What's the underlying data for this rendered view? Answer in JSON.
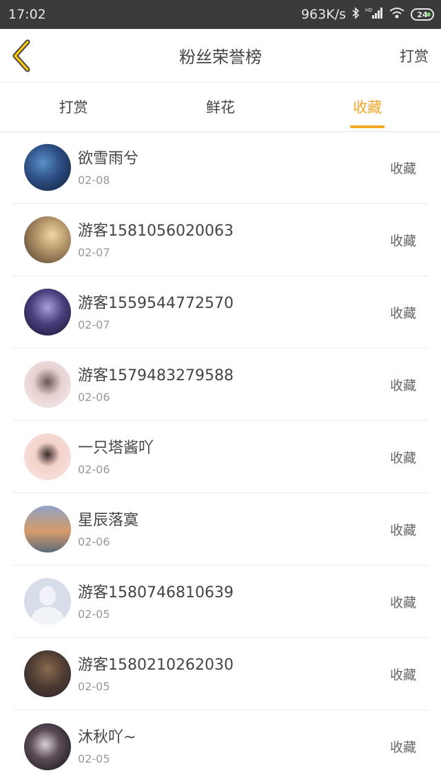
{
  "status_bar": {
    "time": "17:02",
    "network_speed": "963K/s",
    "battery": "24",
    "icons": [
      "bluetooth-icon",
      "hd-signal-icon",
      "wifi-icon",
      "battery-icon"
    ]
  },
  "header": {
    "back_icon": "chevron-left-icon",
    "title": "粉丝荣誉榜",
    "action": "打赏",
    "accent_color": "#f5a623"
  },
  "tabs": [
    {
      "label": "打赏",
      "active": false
    },
    {
      "label": "鲜花",
      "active": false
    },
    {
      "label": "收藏",
      "active": true
    }
  ],
  "list": [
    {
      "name": "欲雪雨兮",
      "date": "02-08",
      "label": "收藏"
    },
    {
      "name": "游客1581056020063",
      "date": "02-07",
      "label": "收藏"
    },
    {
      "name": "游客1559544772570",
      "date": "02-07",
      "label": "收藏"
    },
    {
      "name": "游客1579483279588",
      "date": "02-06",
      "label": "收藏"
    },
    {
      "name": "一只塔酱吖",
      "date": "02-06",
      "label": "收藏"
    },
    {
      "name": "星辰落寞",
      "date": "02-06",
      "label": "收藏"
    },
    {
      "name": "游客1580746810639",
      "date": "02-05",
      "label": "收藏"
    },
    {
      "name": "游客1580210262030",
      "date": "02-05",
      "label": "收藏"
    },
    {
      "name": "沐秋吖~",
      "date": "02-05",
      "label": "收藏"
    }
  ]
}
